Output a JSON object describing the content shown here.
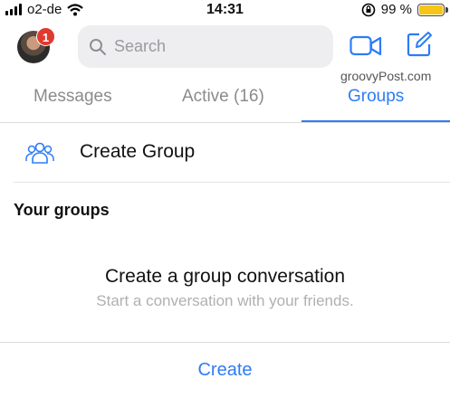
{
  "status_bar": {
    "carrier": "o2-de",
    "time": "14:31",
    "battery_percent": "99 %",
    "battery_level": 0.99,
    "battery_color": "#f5c518"
  },
  "header": {
    "avatar_icon": "user-avatar",
    "notification_count": "1",
    "search_placeholder": "Search",
    "video_icon": "video-camera-icon",
    "compose_icon": "compose-icon",
    "watermark": "groovyPost.com"
  },
  "tabs": [
    {
      "label": "Messages",
      "active": false
    },
    {
      "label": "Active (16)",
      "active": false
    },
    {
      "label": "Groups",
      "active": true
    }
  ],
  "create_group": {
    "label": "Create Group",
    "icon": "group-icon"
  },
  "section_title": "Your groups",
  "empty_state": {
    "title": "Create a group conversation",
    "subtitle": "Start a conversation with your friends."
  },
  "create_button": "Create",
  "colors": {
    "accent": "#2d7cf6",
    "badge": "#e0392f"
  }
}
